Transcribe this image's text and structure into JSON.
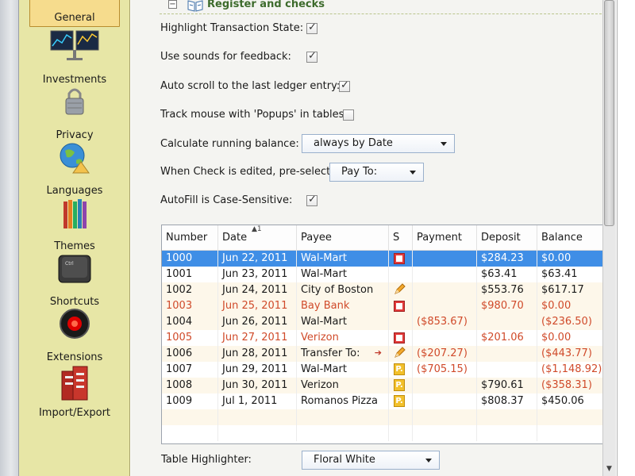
{
  "sidebar": {
    "items": [
      {
        "label": "General",
        "icon": "general-icon",
        "selected": true
      },
      {
        "label": "Investments",
        "icon": "investments-icon"
      },
      {
        "label": "Privacy",
        "icon": "lock-icon"
      },
      {
        "label": "Languages",
        "icon": "globe-icon"
      },
      {
        "label": "Themes",
        "icon": "crayons-icon"
      },
      {
        "label": "Shortcuts",
        "icon": "keyboard-key-icon"
      },
      {
        "label": "Extensions",
        "icon": "extensions-icon"
      },
      {
        "label": "Import/Export",
        "icon": "import-export-icon"
      }
    ]
  },
  "group": {
    "title": "Register and checks",
    "collapse_symbol": "−"
  },
  "options": {
    "highlight_state": {
      "label": "Highlight Transaction State:",
      "checked": true
    },
    "sounds": {
      "label": "Use sounds for feedback:",
      "checked": true
    },
    "auto_scroll": {
      "label": "Auto scroll to the last ledger entry:",
      "checked": true
    },
    "track_mouse": {
      "label": "Track mouse with 'Popups' in tables:",
      "checked": false
    },
    "running_balance": {
      "label": "Calculate running balance:",
      "value": "always by Date"
    },
    "check_edited": {
      "label": "When Check is edited, pre-select:",
      "value": "Pay To:"
    },
    "autofill": {
      "label": "AutoFill is Case-Sensitive:",
      "checked": true
    },
    "table_highlighter": {
      "label": "Table Highlighter:",
      "value": "Floral White"
    }
  },
  "table": {
    "sort_indicator": "▲1",
    "columns": [
      "Number",
      "Date",
      "Payee",
      "S",
      "Payment",
      "Deposit",
      "Balance"
    ],
    "rows": [
      {
        "number": "1000",
        "date": "Jun 22, 2011",
        "payee": "Wal-Mart",
        "status": "red",
        "payment": "",
        "deposit": "$284.23",
        "balance": "$0.00",
        "selected": true
      },
      {
        "number": "1001",
        "date": "Jun 23, 2011",
        "payee": "Wal-Mart",
        "status": "",
        "payment": "",
        "deposit": "$63.41",
        "balance": "$63.41"
      },
      {
        "number": "1002",
        "date": "Jun 24, 2011",
        "payee": "City of Boston",
        "status": "pen",
        "payment": "",
        "deposit": "$553.76",
        "balance": "$617.17",
        "alt": true
      },
      {
        "number": "1003",
        "date": "Jun 25, 2011",
        "payee": "Bay Bank",
        "status": "red",
        "payment": "",
        "deposit": "$980.70",
        "balance": "$0.00",
        "red": true,
        "alt": true
      },
      {
        "number": "1004",
        "date": "Jun 26, 2011",
        "payee": "Wal-Mart",
        "status": "",
        "payment": "($853.67)",
        "deposit": "",
        "balance": "($236.50)",
        "alt": true
      },
      {
        "number": "1005",
        "date": "Jun 27, 2011",
        "payee": "Verizon",
        "status": "red",
        "payment": "",
        "deposit": "$201.06",
        "balance": "$0.00",
        "red": true
      },
      {
        "number": "1006",
        "date": "Jun 28, 2011",
        "payee": "Transfer To:",
        "status": "pen",
        "payment": "($207.27)",
        "deposit": "",
        "balance": "($443.77)",
        "alt": true,
        "transfer": true
      },
      {
        "number": "1007",
        "date": "Jun 29, 2011",
        "payee": "Wal-Mart",
        "status": "p",
        "payment": "($705.15)",
        "deposit": "",
        "balance": "($1,148.92)"
      },
      {
        "number": "1008",
        "date": "Jun 30, 2011",
        "payee": "Verizon",
        "status": "p",
        "payment": "",
        "deposit": "$790.61",
        "balance": "($358.31)",
        "alt": true
      },
      {
        "number": "1009",
        "date": "Jul 1, 2011",
        "payee": "Romanos Pizza",
        "status": "p",
        "payment": "",
        "deposit": "$808.37",
        "balance": "$450.06"
      }
    ]
  },
  "colors": {
    "accent_selection": "#3f8ee6",
    "negative": "#d04a2a",
    "sidebar_bg": "#e7e6a6",
    "group_title": "#3d6b2c"
  }
}
